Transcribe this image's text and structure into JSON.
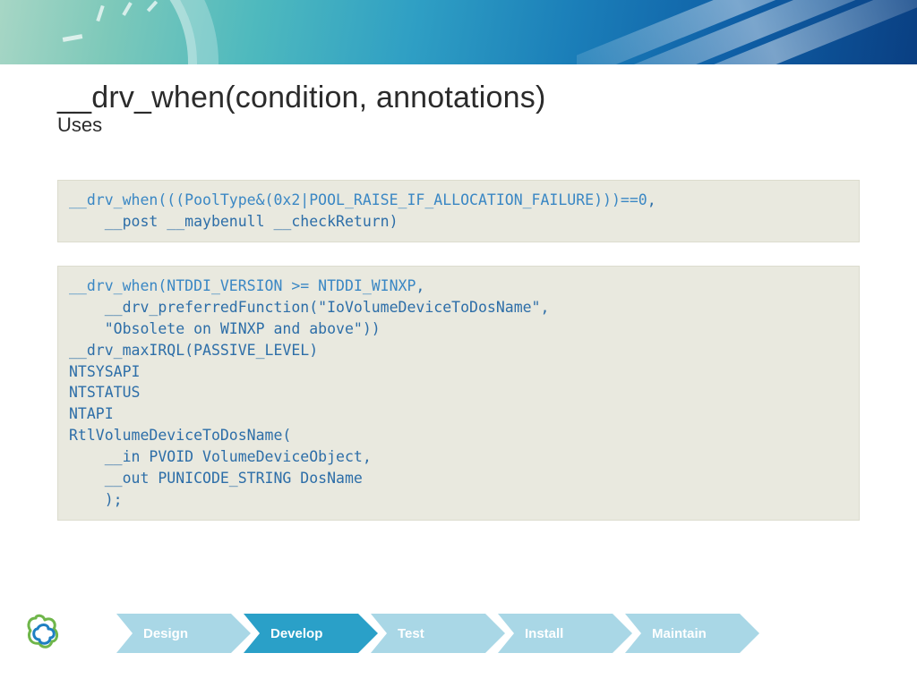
{
  "header": {
    "title": "__drv_when(condition, annotations)",
    "subtitle": "Uses"
  },
  "code_block_1": {
    "line1_hl": "__drv_when(((PoolType&(0x2|POOL_RAISE_IF_ALLOCATION_FAILURE)))==0",
    "line1_tail": ",",
    "line2": "    __post __maybenull __checkReturn)"
  },
  "code_block_2": {
    "l1_hl": "__drv_when(NTDDI_VERSION >= NTDDI_WINXP",
    "l1_tail": ",",
    "l2": "    __drv_preferredFunction(\"IoVolumeDeviceToDosName\",",
    "l3": "    \"Obsolete on WINXP and above\"))",
    "l4": "__drv_maxIRQL(PASSIVE_LEVEL)",
    "l5": "NTSYSAPI",
    "l6": "NTSTATUS",
    "l7": "NTAPI",
    "l8": "RtlVolumeDeviceToDosName(",
    "l9": "    __in PVOID VolumeDeviceObject,",
    "l10": "    __out PUNICODE_STRING DosName",
    "l11": "    );"
  },
  "footer": {
    "steps": [
      "Design",
      "Develop",
      "Test",
      "Install",
      "Maintain"
    ],
    "active_index": 1
  },
  "colors": {
    "step_active": "#2aa0c8",
    "step_inactive": "#a9d7e6",
    "code_bg": "#e9e9df",
    "code_text": "#2d6ea8",
    "code_highlight": "#3a87c4"
  }
}
